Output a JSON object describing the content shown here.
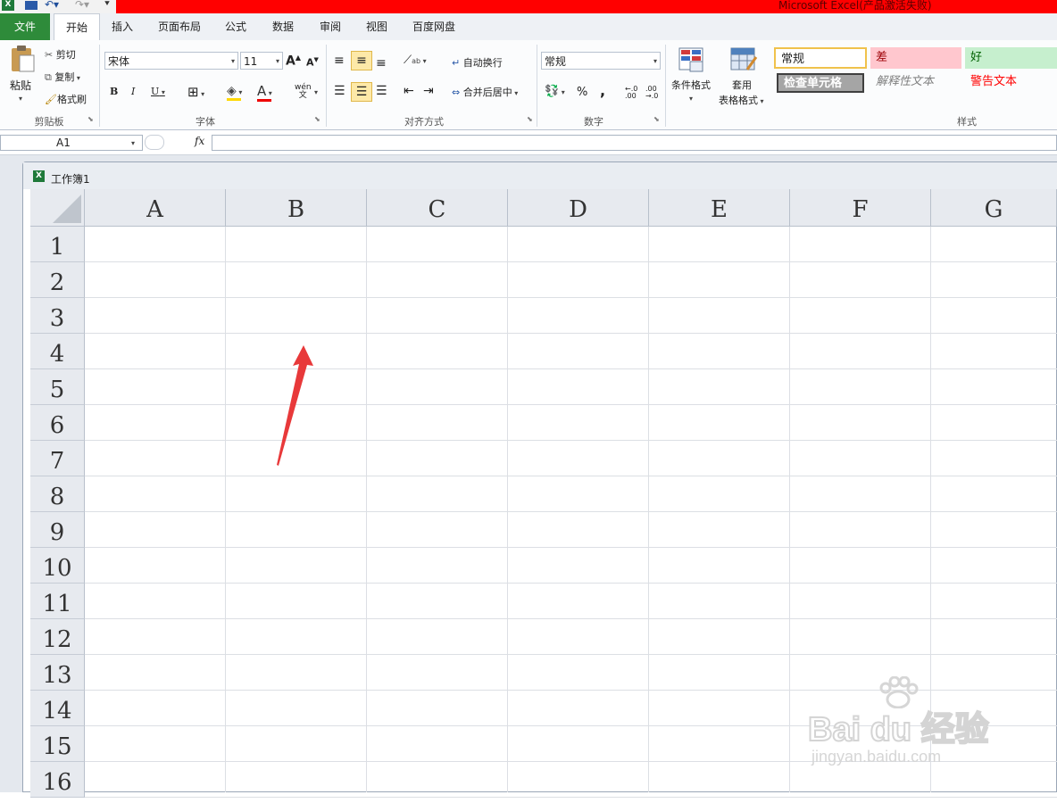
{
  "window": {
    "title": "Microsoft Excel(产品激活失败)"
  },
  "tabs": [
    "文件",
    "开始",
    "插入",
    "页面布局",
    "公式",
    "数据",
    "审阅",
    "视图",
    "百度网盘"
  ],
  "clipboard": {
    "paste": "粘贴",
    "cut": "剪切",
    "copy": "复制",
    "format_painter": "格式刷",
    "label": "剪贴板"
  },
  "font": {
    "name": "宋体",
    "size": "11",
    "bold": "B",
    "italic": "I",
    "underline": "U",
    "grow": "A",
    "shrink": "A",
    "label": "字体",
    "wen": "wén\n文"
  },
  "alignment": {
    "wrap": "自动换行",
    "merge": "合并后居中",
    "label": "对齐方式"
  },
  "number": {
    "format": "常规",
    "percent": "%",
    "comma": ",",
    "inc": "←.0\n.00",
    "dec": ".00\n→.0",
    "label": "数字"
  },
  "styles_group": {
    "conditional": "条件格式",
    "table_line1": "套用",
    "table_line2": "表格格式",
    "label": "样式",
    "cells": [
      "常规",
      "差",
      "好",
      "检查单元格",
      "解释性文本",
      "警告文本"
    ]
  },
  "formula_bar": {
    "name_box": "A1",
    "fx": "fx",
    "formula": ""
  },
  "workbook": {
    "title": "工作簿1"
  },
  "sheet": {
    "columns": [
      "A",
      "B",
      "C",
      "D",
      "E",
      "F",
      "G"
    ],
    "rows": [
      "1",
      "2",
      "3",
      "4",
      "5",
      "6",
      "7",
      "8",
      "9",
      "10",
      "11",
      "12",
      "13",
      "14",
      "15",
      "16"
    ]
  },
  "colors": {
    "title_bar": "#ff0000",
    "file_tab": "#2e8b3a",
    "arrow": "#e8393a",
    "bad_bg": "#ffc7ce",
    "bad_fg": "#9c0006",
    "good_bg": "#c6efce",
    "good_fg": "#006100",
    "warning_fg": "#ff0000",
    "check_bg": "#a5a5a5"
  },
  "watermark": {
    "brand": "Bai du 经验",
    "url": "jingyan.baidu.com"
  }
}
